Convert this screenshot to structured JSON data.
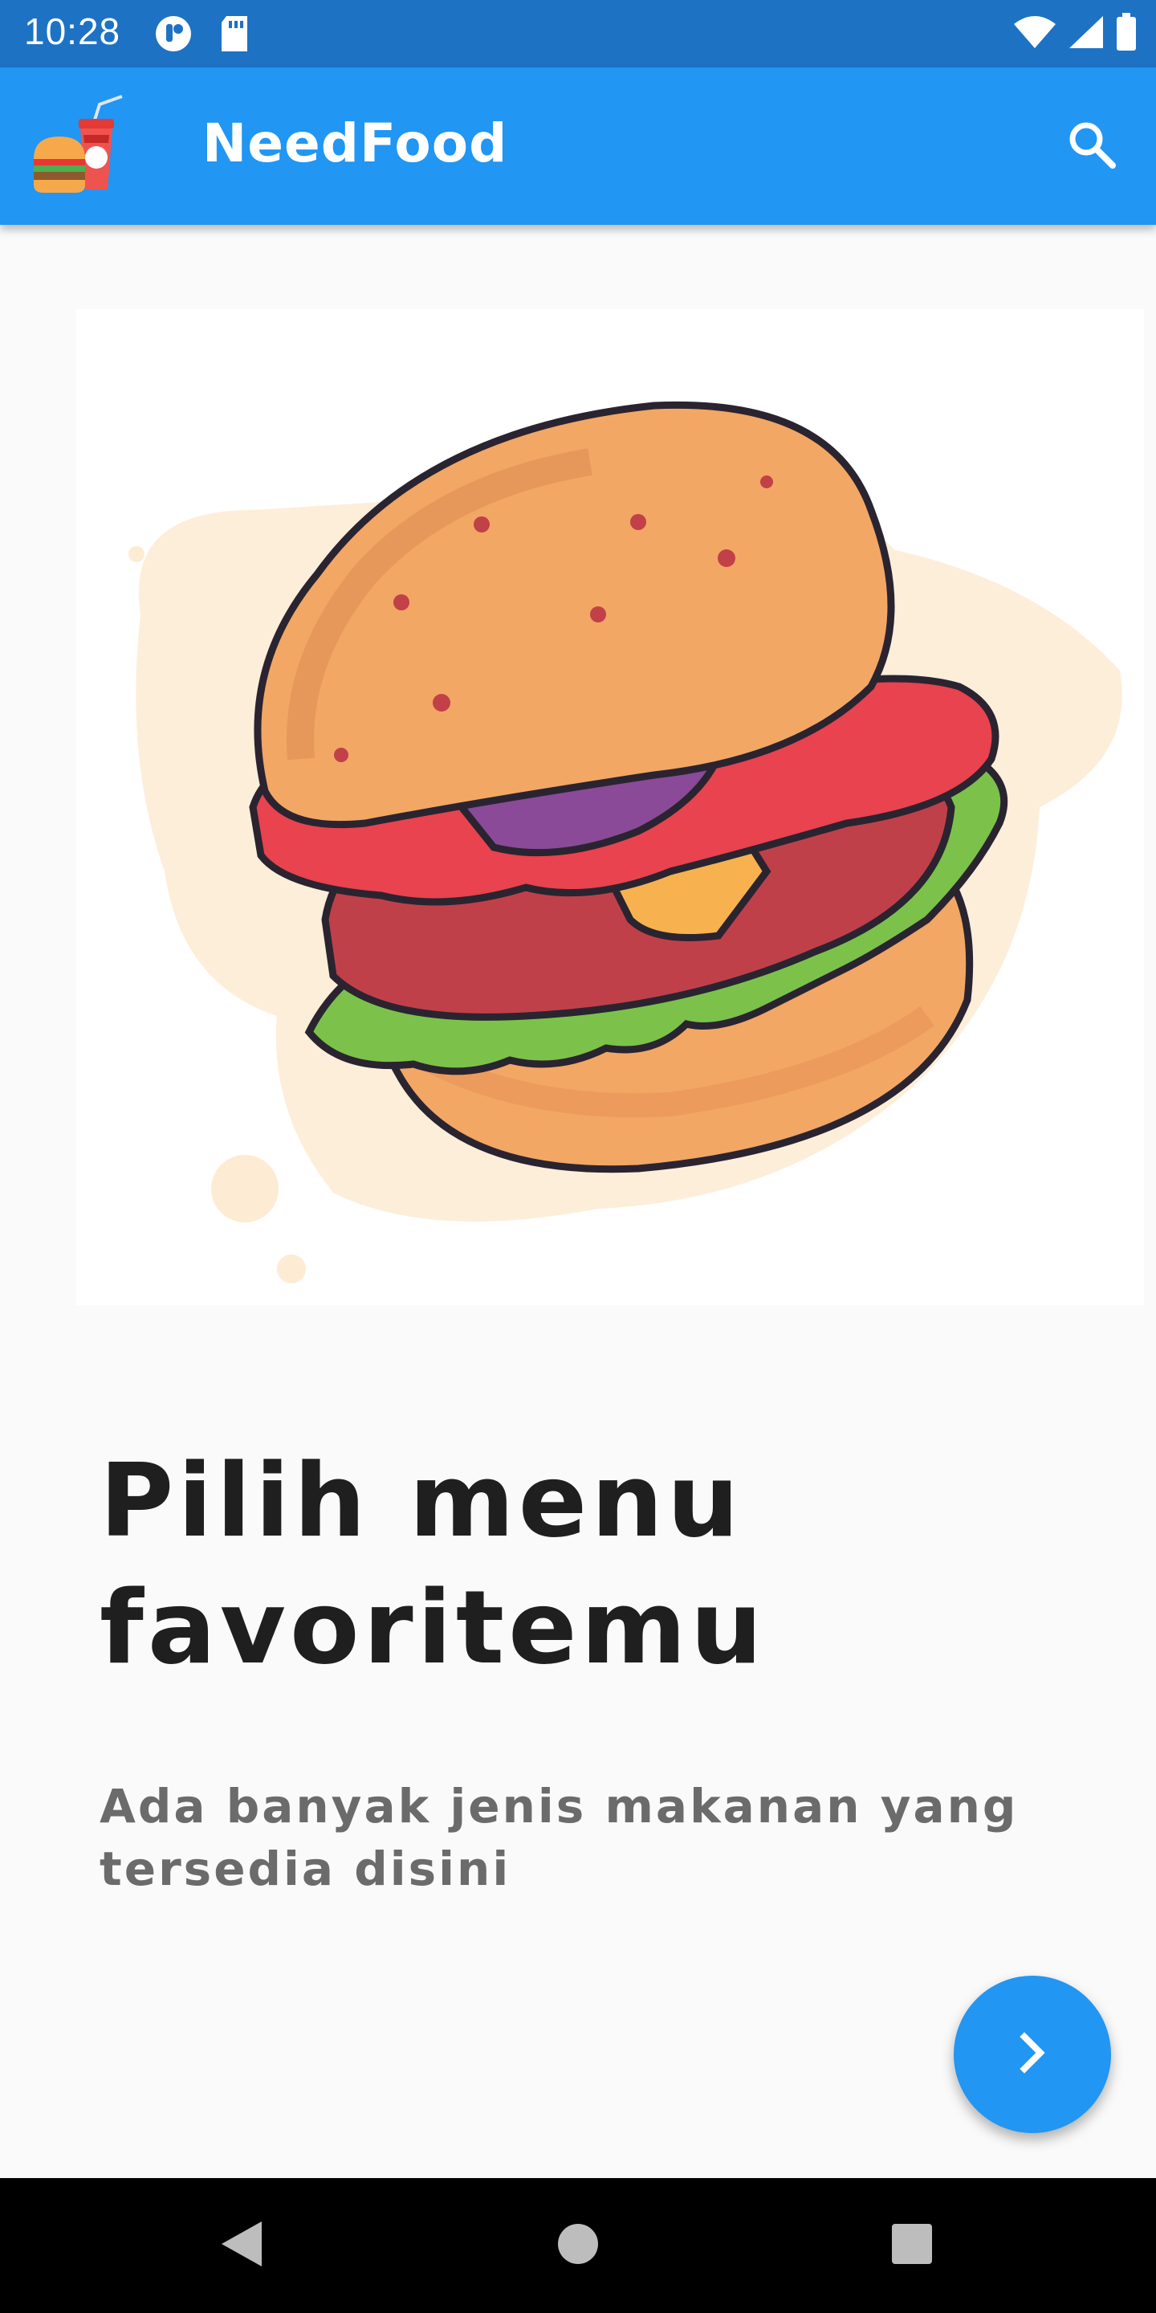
{
  "status_bar": {
    "time": "10:28",
    "icons": [
      "app-notification-icon",
      "sd-card-icon",
      "wifi-icon",
      "signal-icon",
      "battery-icon"
    ]
  },
  "app_bar": {
    "title": "NeedFood",
    "logo_icon": "burger-drink-logo-icon",
    "search_icon": "search-icon",
    "background_color": "#2196f3"
  },
  "hero": {
    "illustration": "burger-illustration"
  },
  "content": {
    "headline": "Pilih menu favoritemu",
    "subtitle": "Ada banyak jenis makanan yang tersedia disini"
  },
  "fab": {
    "icon": "chevron-right-icon",
    "color": "#2196f3"
  },
  "nav_bar": {
    "icons": [
      "back-icon",
      "home-icon",
      "recents-icon"
    ]
  }
}
